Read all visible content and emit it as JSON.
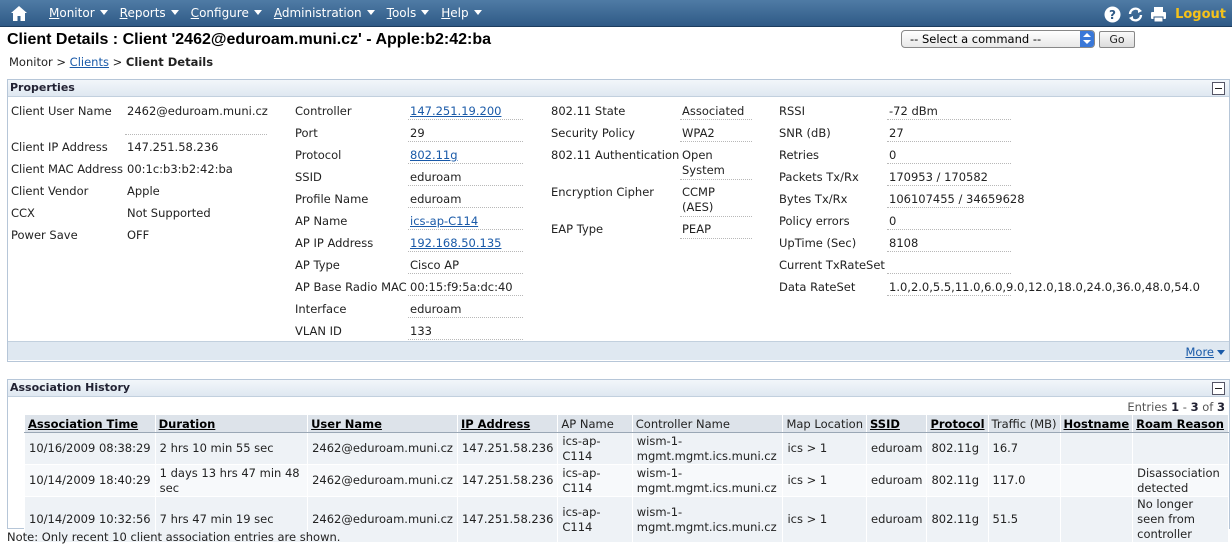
{
  "nav": {
    "menus": [
      {
        "first": "M",
        "rest": "onitor"
      },
      {
        "first": "R",
        "rest": "eports"
      },
      {
        "first": "C",
        "rest": "onfigure"
      },
      {
        "first": "A",
        "rest": "dministration"
      },
      {
        "first": "T",
        "rest": "ools"
      },
      {
        "first": "H",
        "rest": "elp"
      }
    ],
    "logout": "Logout"
  },
  "header": {
    "title": "Client Details : Client '2462@eduroam.muni.cz' - Apple:b2:42:ba",
    "command_select": "-- Select a command --",
    "go": "Go"
  },
  "breadcrumb": {
    "root": "Monitor",
    "sep1": ">",
    "clients": "Clients",
    "sep2": ">",
    "current": "Client Details"
  },
  "properties": {
    "title": "Properties",
    "col1": [
      {
        "label": "Client User Name",
        "value": "2462@eduroam.muni.cz"
      },
      {
        "label": "Client IP Address",
        "value": "147.251.58.236"
      },
      {
        "label": "Client MAC Address",
        "value": "00:1c:b3:b2:42:ba"
      },
      {
        "label": "Client Vendor",
        "value": "Apple"
      },
      {
        "label": "CCX",
        "value": "Not Supported"
      },
      {
        "label": "Power Save",
        "value": "OFF"
      }
    ],
    "col2": [
      {
        "label": "Controller",
        "value": "147.251.19.200"
      },
      {
        "label": "Port",
        "value": "29"
      },
      {
        "label": "Protocol",
        "value": "802.11g"
      },
      {
        "label": "SSID",
        "value": "eduroam"
      },
      {
        "label": "Profile Name",
        "value": "eduroam"
      },
      {
        "label": "AP Name",
        "value": "ics-ap-C114"
      },
      {
        "label": "AP IP Address",
        "value": "192.168.50.135"
      },
      {
        "label": "AP Type",
        "value": "Cisco AP"
      },
      {
        "label": "AP Base Radio MAC",
        "value": "00:15:f9:5a:dc:40"
      },
      {
        "label": "Interface",
        "value": "eduroam"
      },
      {
        "label": "VLAN ID",
        "value": "133"
      }
    ],
    "col3": [
      {
        "label": "802.11 State",
        "value": "Associated"
      },
      {
        "label": "Security Policy",
        "value": "WPA2"
      },
      {
        "label": "802.11 Authentication",
        "value": "Open System"
      },
      {
        "label": "Encryption Cipher",
        "value": "CCMP (AES)"
      },
      {
        "label": "EAP Type",
        "value": "PEAP"
      }
    ],
    "col4": [
      {
        "label": "RSSI",
        "value": "-72 dBm"
      },
      {
        "label": "SNR (dB)",
        "value": "27"
      },
      {
        "label": "Retries",
        "value": "0"
      },
      {
        "label": "Packets Tx/Rx",
        "value": "170953 / 170582"
      },
      {
        "label": "Bytes Tx/Rx",
        "value": "106107455 / 34659628"
      },
      {
        "label": "Policy errors",
        "value": "0"
      },
      {
        "label": "UpTime (Sec)",
        "value": "8108"
      },
      {
        "label": "Current TxRateSet",
        "value": ""
      },
      {
        "label": "Data RateSet",
        "value": "1.0,2.0,5.5,11.0,6.0,9.0,12.0,18.0,24.0,36.0,48.0,54.0"
      }
    ],
    "more": "More"
  },
  "history": {
    "title": "Association History",
    "entries_label": "Entries",
    "entries_from": "1",
    "entries_dash": "-",
    "entries_to": "3",
    "entries_of": "of",
    "entries_total": "3",
    "columns": [
      "Association Time",
      "Duration",
      "User Name",
      "IP Address",
      "AP Name",
      "Controller Name",
      "Map Location",
      "SSID",
      "Protocol",
      "Traffic (MB)",
      "Hostname",
      "Roam Reason"
    ],
    "rows": [
      [
        "10/16/2009 08:38:29",
        "2 hrs 10 min 55 sec",
        "2462@eduroam.muni.cz",
        "147.251.58.236",
        "ics-ap-C114",
        "wism-1-mgmt.mgmt.ics.muni.cz",
        "ics > 1",
        "eduroam",
        "802.11g",
        "16.7",
        "",
        ""
      ],
      [
        "10/14/2009 18:40:29",
        "1 days 13 hrs 47 min 48 sec",
        "2462@eduroam.muni.cz",
        "147.251.58.236",
        "ics-ap-C114",
        "wism-1-mgmt.mgmt.ics.muni.cz",
        "ics > 1",
        "eduroam",
        "802.11g",
        "117.0",
        "",
        "Disassociation detected"
      ],
      [
        "10/14/2009 10:32:56",
        "7 hrs 47 min 19 sec",
        "2462@eduroam.muni.cz",
        "147.251.58.236",
        "ics-ap-C114",
        "wism-1-mgmt.mgmt.ics.muni.cz",
        "ics > 1",
        "eduroam",
        "802.11g",
        "51.5",
        "",
        "No longer seen from controller"
      ]
    ],
    "note": "Note: Only recent 10 client association entries are shown."
  }
}
